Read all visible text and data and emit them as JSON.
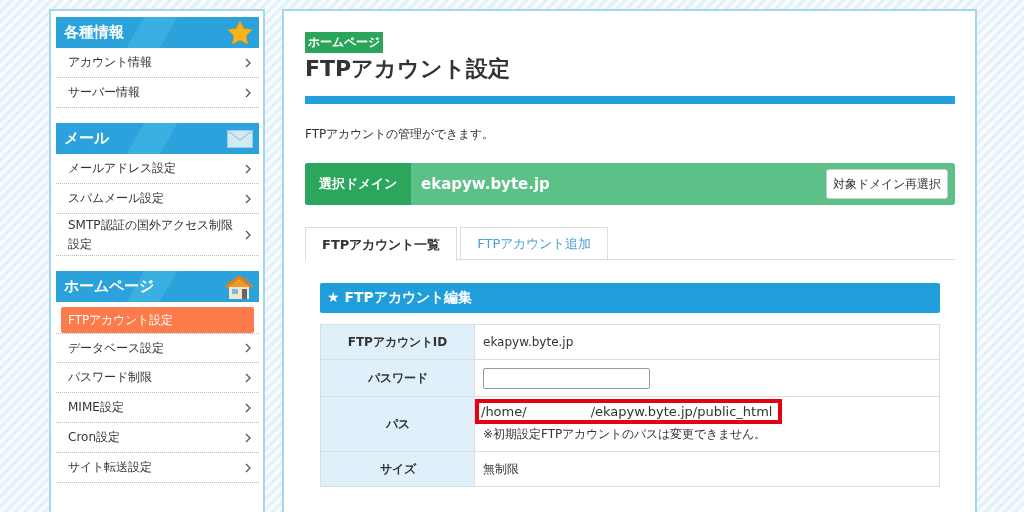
{
  "sidebar": {
    "sections": [
      {
        "title": "各種情報",
        "items": [
          {
            "label": "アカウント情報",
            "selected": false
          },
          {
            "label": "サーバー情報",
            "selected": false
          }
        ]
      },
      {
        "title": "メール",
        "items": [
          {
            "label": "メールアドレス設定",
            "selected": false
          },
          {
            "label": "スパムメール設定",
            "selected": false
          },
          {
            "label": "SMTP認証の国外アクセス制限設定",
            "selected": false
          }
        ]
      },
      {
        "title": "ホームページ",
        "items": [
          {
            "label": "FTPアカウント設定",
            "selected": true
          },
          {
            "label": "データベース設定",
            "selected": false
          },
          {
            "label": "パスワード制限",
            "selected": false
          },
          {
            "label": "MIME設定",
            "selected": false
          },
          {
            "label": "Cron設定",
            "selected": false
          },
          {
            "label": "サイト転送設定",
            "selected": false
          }
        ]
      }
    ]
  },
  "main": {
    "category_badge": "ホームページ",
    "title": "FTPアカウント設定",
    "description": "FTPアカウントの管理ができます。",
    "domain_bar": {
      "label": "選択ドメイン",
      "domain": "ekapyw.byte.jp",
      "button": "対象ドメイン再選択"
    },
    "tabs": [
      {
        "label": "FTPアカウント一覧",
        "selected": true
      },
      {
        "label": "FTPアカウント追加",
        "selected": false
      }
    ],
    "edit_panel": {
      "icon_char": "★",
      "title": "FTPアカウント編集",
      "rows": [
        {
          "kind": "text",
          "label": "FTPアカウントID",
          "value": "ekapyw.byte.jp"
        },
        {
          "kind": "input",
          "label": "パスワード"
        },
        {
          "kind": "path",
          "label": "パス",
          "path_start": "/home/",
          "path_end": "/ekapyw.byte.jp/public_html",
          "note": "※初期設定FTPアカウントのパスは変更できません。"
        },
        {
          "kind": "text",
          "label": "サイズ",
          "value": "無制限"
        }
      ]
    }
  }
}
